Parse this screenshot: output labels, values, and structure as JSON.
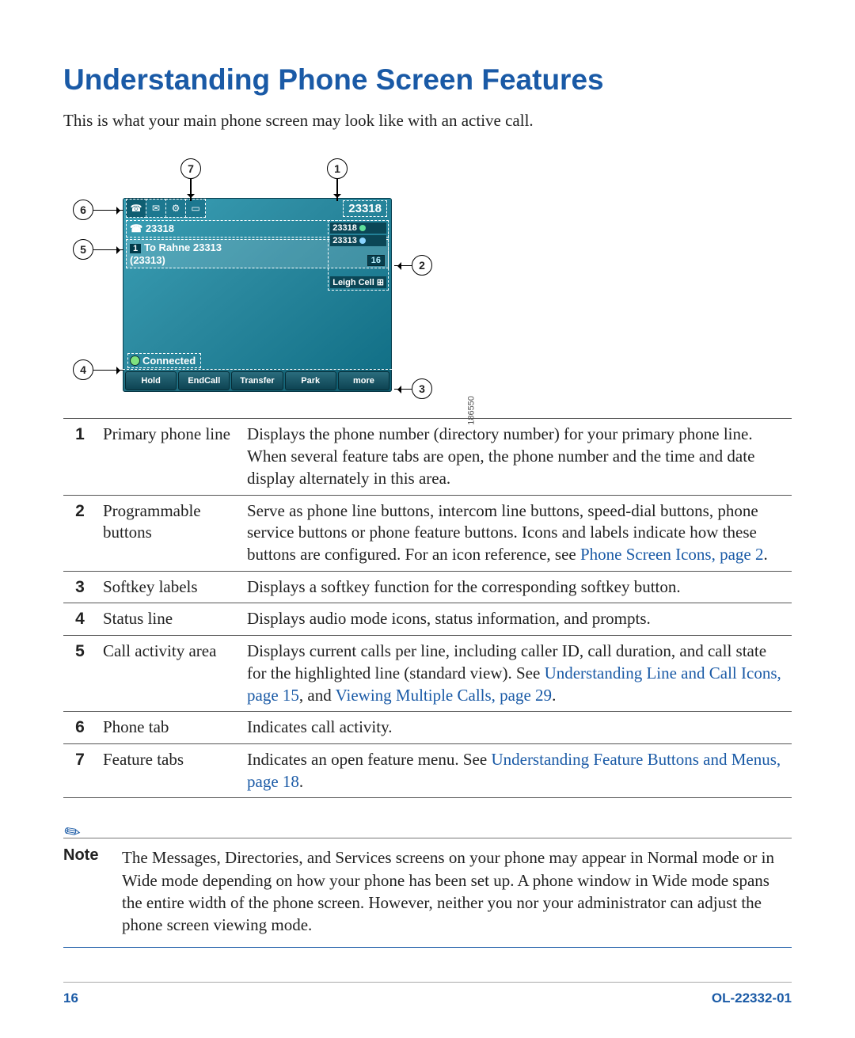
{
  "heading": "Understanding Phone Screen Features",
  "intro": "This is what your main phone screen may look like with an active call.",
  "figure": {
    "line_number": "23318",
    "line_label": "23318",
    "call_index": "1",
    "call_to": "To Rahne 23313",
    "call_number": "(23313)",
    "call_timer": "16",
    "prog_btn_1": "23318",
    "prog_btn_2": "23313",
    "prog_btn_3": "Leigh Cell",
    "status": "Connected",
    "softkeys": [
      "Hold",
      "EndCall",
      "Transfer",
      "Park",
      "more"
    ],
    "image_id": "186550"
  },
  "callouts": [
    "1",
    "2",
    "3",
    "4",
    "5",
    "6",
    "7"
  ],
  "legend": [
    {
      "num": "1",
      "name": "Primary phone line",
      "desc": "Displays the phone number (directory number) for your primary phone line. When several feature tabs are open, the phone number and the time and date display alternately in this area."
    },
    {
      "num": "2",
      "name": "Programmable buttons",
      "desc_a": "Serve as phone line buttons, intercom line buttons, speed-dial buttons, phone service buttons or phone feature buttons. Icons and labels indicate how these buttons are configured. For an icon reference, see ",
      "link": "Phone Screen Icons, page 2",
      "desc_b": "."
    },
    {
      "num": "3",
      "name": "Softkey labels",
      "desc": "Displays a softkey function for the corresponding softkey button."
    },
    {
      "num": "4",
      "name": "Status line",
      "desc": "Displays audio mode icons, status information, and prompts."
    },
    {
      "num": "5",
      "name": "Call activity area",
      "desc_a": "Displays current calls per line, including caller ID, call duration, and call state for the highlighted line (standard view). See ",
      "link": "Understanding Line and Call Icons, page 15",
      "desc_b": ", and ",
      "link2": "Viewing Multiple Calls, page 29",
      "desc_c": "."
    },
    {
      "num": "6",
      "name": "Phone tab",
      "desc": "Indicates call activity."
    },
    {
      "num": "7",
      "name": "Feature tabs",
      "desc_a": "Indicates an open feature menu. See ",
      "link": "Understanding Feature Buttons and Menus, page 18",
      "desc_b": "."
    }
  ],
  "note": {
    "label": "Note",
    "text": "The Messages, Directories, and Services screens on your phone may appear in Normal mode or in Wide mode depending on how your phone has been set up. A phone window in Wide mode spans the entire width of the phone screen. However, neither you nor your administrator can adjust the phone screen viewing mode."
  },
  "footer": {
    "page": "16",
    "doc_id": "OL-22332-01"
  }
}
